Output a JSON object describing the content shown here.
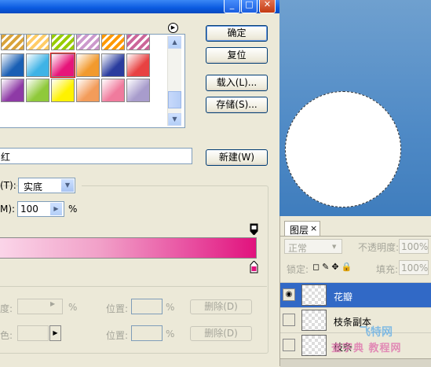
{
  "dialog": {
    "buttons": {
      "ok": "确定",
      "reset": "复位",
      "load": "载入(L)...",
      "save": "存储(S)...",
      "new": "新建(W)"
    },
    "name_value": "红",
    "type_label": "(T):",
    "type_value": "实底",
    "smoothness_label": "M):",
    "smoothness_value": "100",
    "smoothness_unit": "%",
    "stops": {
      "opacity_label": "度:",
      "opacity_unit": "%",
      "color_label": "色:",
      "location_label": "位置:",
      "location_unit": "%",
      "delete_label": "删除(D)"
    },
    "gradient": {
      "start_color": "#fbd7ea",
      "end_color": "#e1127d"
    }
  },
  "presets": {
    "rows": [
      [
        "#d9a33a",
        "#ffcc66",
        "#99cc00",
        "#cc99cc",
        "#ff9900",
        "#cc6699"
      ],
      [
        "#1a5fb4",
        "#3fb3e6",
        "#e6157a",
        "#f29a2e",
        "#2a3c9e",
        "#e84242"
      ],
      [
        "#8e3aa6",
        "#8fc93a",
        "#fff200",
        "#f39c5a",
        "#f07b9d",
        "#a89ccc"
      ]
    ],
    "selected_index": 8
  },
  "layers_panel": {
    "tab_label": "图层",
    "tab_close": "×",
    "blend_mode": "正常",
    "opacity_label": "不透明度:",
    "opacity_value": "100%",
    "lock_label": "锁定:",
    "lock_icons": "◻✎✥🔒",
    "fill_label": "填充:",
    "fill_value": "100%",
    "layers": [
      {
        "name": "花瓣",
        "visible": true,
        "active": true
      },
      {
        "name": "枝条副本",
        "visible": false,
        "active": false
      },
      {
        "name": "枝条",
        "visible": false,
        "active": false
      }
    ]
  },
  "watermark": {
    "line1": "查字典 教程网",
    "line2": "飞特网"
  },
  "colors": {
    "selection": "#3169c6",
    "canvas_top": "#6fa0cf",
    "canvas_bottom": "#3f7dbd"
  }
}
